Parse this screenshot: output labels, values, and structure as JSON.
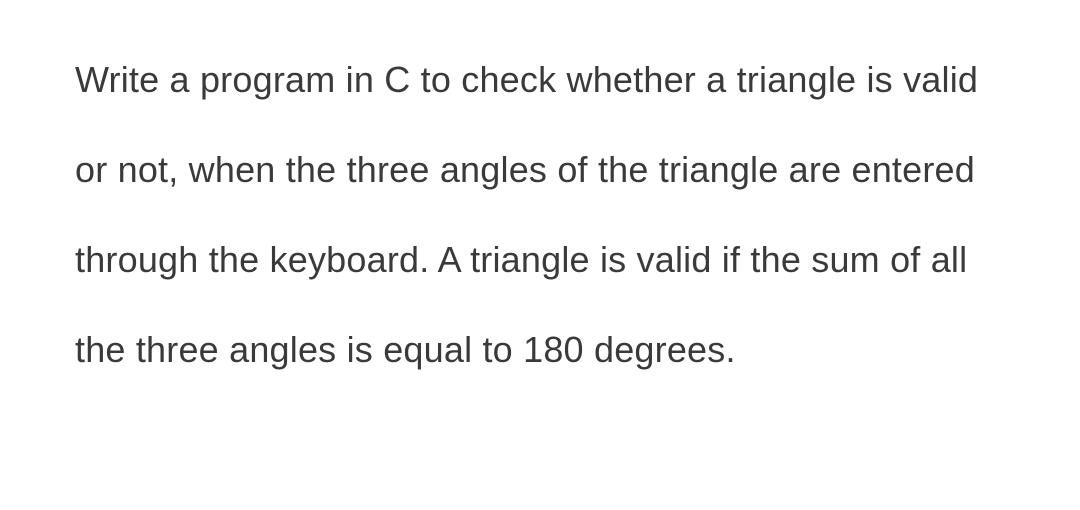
{
  "question": {
    "text": "Write a program in C to check whether a triangle is valid or not, when the three angles of the triangle are entered through the keyboard. A triangle is valid if the sum of all the three angles is equal to 180 degrees."
  }
}
